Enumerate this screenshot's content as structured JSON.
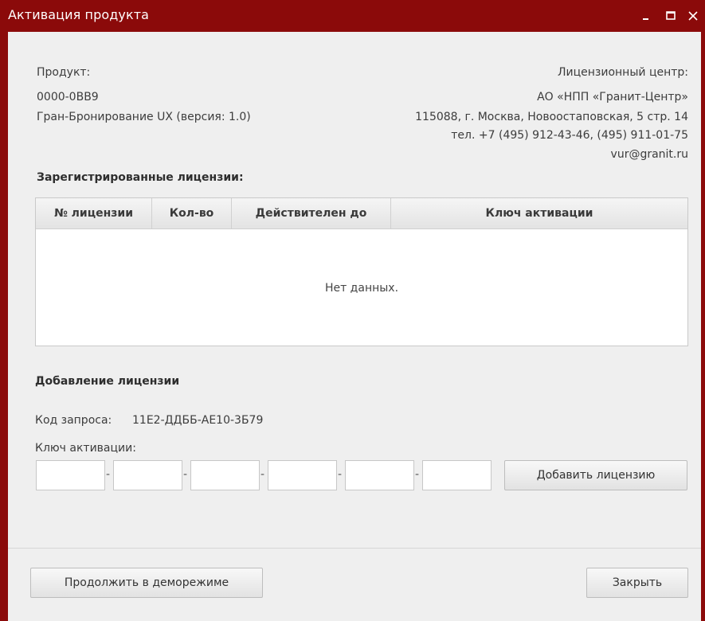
{
  "window": {
    "title": "Активация продукта",
    "titlebar_color": "#8b0a0a"
  },
  "product": {
    "label": "Продукт:",
    "code": "0000-0BB9",
    "name": "Гран-Бронирование UX (версия: 1.0)"
  },
  "license_center": {
    "label": "Лицензионный центр:",
    "org": "АО «НПП «Гранит-Центр»",
    "address": "115088, г. Москва, Новоостаповская, 5 стр. 14",
    "phones": "тел. +7 (495) 912-43-46, (495) 911-01-75",
    "email": "vur@granit.ru"
  },
  "licenses": {
    "heading": "Зарегистрированные лицензии:",
    "columns": [
      "№ лицензии",
      "Кол-во",
      "Действителен до",
      "Ключ активации"
    ],
    "rows": [],
    "empty_text": "Нет данных."
  },
  "add_license": {
    "heading": "Добавление лицензии",
    "request_code_label": "Код запроса:",
    "request_code": "11E2-ДДББ-AE10-3Б79",
    "key_label": "Ключ активации:",
    "key_segments": [
      "",
      "",
      "",
      "",
      "",
      ""
    ],
    "separator": "-",
    "add_button": "Добавить лицензию"
  },
  "footer": {
    "demo_button": "Продолжить в деморежиме",
    "close_button": "Закрыть"
  }
}
